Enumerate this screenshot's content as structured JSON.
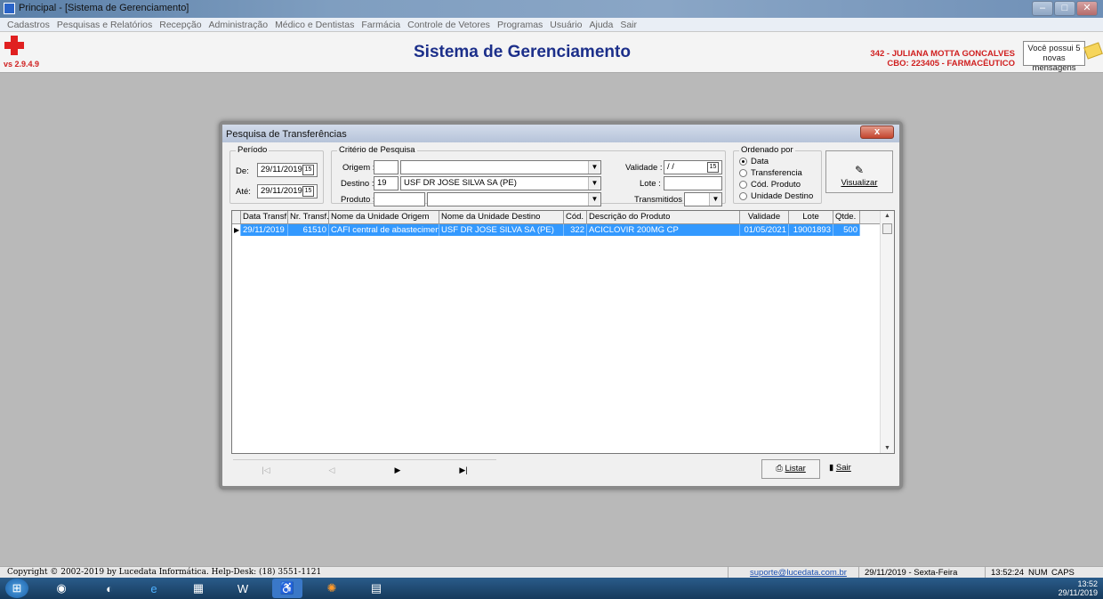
{
  "window": {
    "title": "Principal - [Sistema de Gerenciamento]",
    "min": "–",
    "max": "□",
    "close": "✕"
  },
  "menu": [
    "Cadastros",
    "Pesquisas e Relatórios",
    "Recepção",
    "Administração",
    "Médico e Dentistas",
    "Farmácia",
    "Controle de Vetores",
    "Programas",
    "Usuário",
    "Ajuda",
    "Sair"
  ],
  "header": {
    "version": "vs 2.9.4.9",
    "title": "Sistema de Gerenciamento",
    "user": "342 - JULIANA MOTTA GONCALVES",
    "cbo": "CBO: 223405 - FARMACÊUTICO",
    "messages_line1": "Você possui 5",
    "messages_line2": "novas mensagens"
  },
  "dialog": {
    "title": "Pesquisa de Transferências",
    "close": "x",
    "periodo": {
      "legend": "Período",
      "de_label": "De:",
      "de_value": "29/11/2019",
      "ate_label": "Até:",
      "ate_value": "29/11/2019"
    },
    "criterio": {
      "legend": "Critério de Pesquisa",
      "origem_label": "Origem :",
      "origem_code": "",
      "origem_name": "",
      "destino_label": "Destino :",
      "destino_code": "19",
      "destino_name": "USF DR JOSE SILVA SA (PE)",
      "produto_label": "Produto :",
      "produto_code": "",
      "produto_name": "",
      "validade_label": "Validade :",
      "validade_value": " / /",
      "lote_label": "Lote :",
      "lote_value": "",
      "transmitidos_label": "Transmitidos :",
      "transmitidos_value": ""
    },
    "ordenado": {
      "legend": "Ordenado por",
      "options": [
        "Data",
        "Transferencia",
        "Cód. Produto",
        "Unidade Destino"
      ],
      "selected": "Data"
    },
    "visualizar": "Visualizar",
    "grid": {
      "headers": [
        "Data Transf.",
        "Nr. Transf.",
        "Nome da Unidade Origem",
        "Nome da Unidade Destino",
        "Cód.",
        "Descrição do Produto",
        "Validade",
        "Lote",
        "Qtde."
      ],
      "rows": [
        [
          "29/11/2019",
          "61510",
          "CAFI central de abastecimento fa",
          "USF DR JOSE SILVA SA (PE)",
          "322",
          "ACICLOVIR 200MG CP",
          "01/05/2021",
          "19001893",
          "500"
        ]
      ]
    },
    "nav": [
      "|◁",
      "◁",
      "▶",
      "▶|"
    ],
    "listar": "Listar",
    "sair": "Sair"
  },
  "status": {
    "copyright": "Copyright © 2002-2019 by Lucedata Informática. Help-Desk: (18) 3551-1121",
    "email": "suporte@lucedata.com.br",
    "date": "29/11/2019 - Sexta-Feira",
    "time": "13:52:24",
    "num": "NUM",
    "caps": "CAPS"
  },
  "taskbar": {
    "time": "13:52",
    "date": "29/11/2019"
  }
}
